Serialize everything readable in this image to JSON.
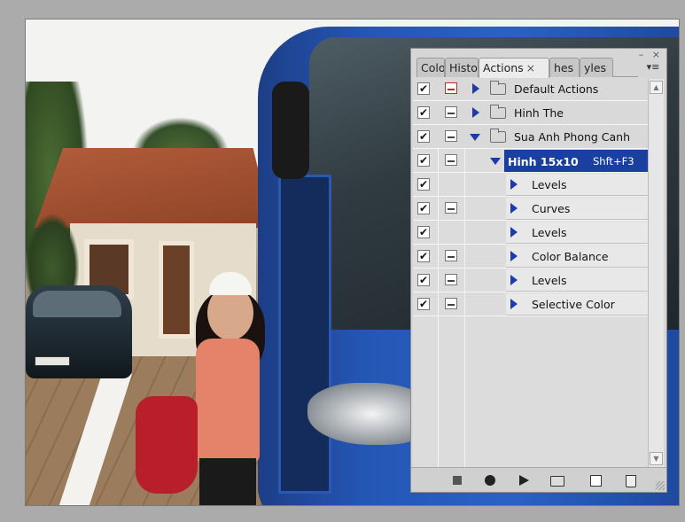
{
  "panel": {
    "window_controls": "– ×",
    "tabs": [
      {
        "label": "Colo",
        "active": false
      },
      {
        "label": "Histo",
        "active": false
      },
      {
        "label": "Actions",
        "active": true,
        "close": "×"
      },
      {
        "label": "hes",
        "active": false
      },
      {
        "label": "yles",
        "active": false
      }
    ],
    "menu_icon": "≡",
    "actions": [
      {
        "checked": true,
        "dialog": "red",
        "expand": "right",
        "type": "set",
        "name": "Default Actions"
      },
      {
        "checked": true,
        "dialog": "on",
        "expand": "right",
        "type": "set",
        "name": "Hinh The"
      },
      {
        "checked": true,
        "dialog": "on",
        "expand": "down",
        "type": "set",
        "name": "Sua Anh Phong Canh"
      },
      {
        "checked": true,
        "dialog": "on",
        "expand": "down",
        "type": "action",
        "name": "Hinh 15x10",
        "shortcut": "Shft+F3",
        "selected": true
      },
      {
        "checked": true,
        "dialog": "none",
        "expand": "right",
        "type": "step",
        "name": "Levels"
      },
      {
        "checked": true,
        "dialog": "on",
        "expand": "right",
        "type": "step",
        "name": "Curves"
      },
      {
        "checked": true,
        "dialog": "none",
        "expand": "right",
        "type": "step",
        "name": "Levels"
      },
      {
        "checked": true,
        "dialog": "on",
        "expand": "right",
        "type": "step",
        "name": "Color Balance"
      },
      {
        "checked": true,
        "dialog": "on",
        "expand": "right",
        "type": "step",
        "name": "Levels"
      },
      {
        "checked": true,
        "dialog": "on",
        "expand": "right",
        "type": "step",
        "name": "Selective Color"
      }
    ],
    "check_glyph": "✔",
    "bottom_buttons": [
      "stop-recording",
      "start-recording",
      "play-selection",
      "create-new-set",
      "create-new-action",
      "delete"
    ],
    "colors": {
      "selection": "#1b3fa0",
      "expander": "#1d3aa8",
      "panel_bg": "#d6d6d6"
    }
  }
}
